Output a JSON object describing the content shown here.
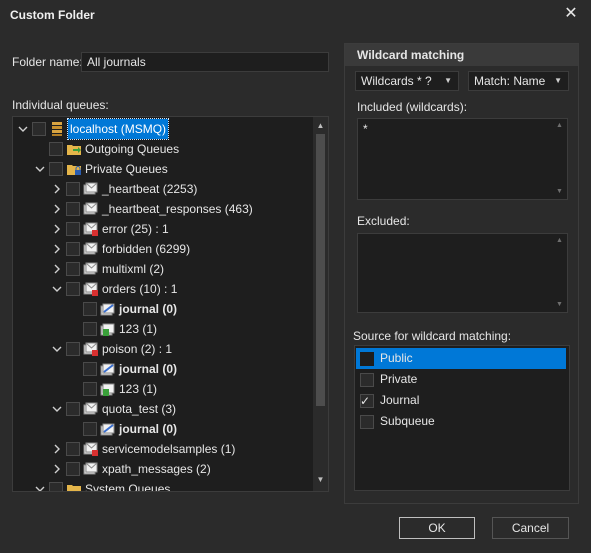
{
  "dialog": {
    "title": "Custom Folder",
    "close_glyph": "✕"
  },
  "folder_name": {
    "label": "Folder name:",
    "value": "All journals"
  },
  "queues_label": "Individual queues:",
  "tree": [
    {
      "id": "localhost",
      "label": "localhost (MSMQ)",
      "icon": "server-icon",
      "expander": "expanded",
      "checkbox": true,
      "selected": true,
      "bold": false
    },
    {
      "id": "outgoing",
      "label": "Outgoing Queues",
      "icon": "outgoing-folder-icon",
      "expander": "none",
      "checkbox": true,
      "selected": false,
      "bold": false
    },
    {
      "id": "private",
      "label": "Private Queues",
      "icon": "private-folder-icon",
      "expander": "expanded",
      "checkbox": true,
      "selected": false,
      "bold": false
    },
    {
      "id": "heartbeat",
      "label": "_heartbeat (2253)",
      "icon": "queue-icon",
      "expander": "collapsed",
      "checkbox": true,
      "selected": false,
      "bold": false
    },
    {
      "id": "heartbeat_responses",
      "label": "_heartbeat_responses (463)",
      "icon": "queue-icon",
      "expander": "collapsed",
      "checkbox": true,
      "selected": false,
      "bold": false
    },
    {
      "id": "error",
      "label": "error (25) : 1",
      "icon": "queue-error-icon",
      "expander": "collapsed",
      "checkbox": true,
      "selected": false,
      "bold": false
    },
    {
      "id": "forbidden",
      "label": "forbidden (6299)",
      "icon": "queue-icon",
      "expander": "collapsed",
      "checkbox": true,
      "selected": false,
      "bold": false
    },
    {
      "id": "multixml",
      "label": "multixml (2)",
      "icon": "queue-icon",
      "expander": "collapsed",
      "checkbox": true,
      "selected": false,
      "bold": false
    },
    {
      "id": "orders",
      "label": "orders (10) : 1",
      "icon": "queue-error-icon",
      "expander": "expanded",
      "checkbox": true,
      "selected": false,
      "bold": false
    },
    {
      "id": "orders_journal",
      "label": "journal (0)",
      "icon": "journal-icon",
      "expander": "none",
      "checkbox": true,
      "selected": false,
      "bold": true
    },
    {
      "id": "orders_123",
      "label": "123 (1)",
      "icon": "subqueue-icon",
      "expander": "none",
      "checkbox": true,
      "selected": false,
      "bold": false
    },
    {
      "id": "poison",
      "label": "poison (2) : 1",
      "icon": "queue-error-icon",
      "expander": "expanded",
      "checkbox": true,
      "selected": false,
      "bold": false
    },
    {
      "id": "poison_journal",
      "label": "journal (0)",
      "icon": "journal-icon",
      "expander": "none",
      "checkbox": true,
      "selected": false,
      "bold": true
    },
    {
      "id": "poison_123",
      "label": "123 (1)",
      "icon": "subqueue-icon",
      "expander": "none",
      "checkbox": true,
      "selected": false,
      "bold": false
    },
    {
      "id": "quota_test",
      "label": "quota_test (3)",
      "icon": "queue-icon",
      "expander": "expanded",
      "checkbox": true,
      "selected": false,
      "bold": false
    },
    {
      "id": "quota_journal",
      "label": "journal (0)",
      "icon": "journal-icon",
      "expander": "none",
      "checkbox": true,
      "selected": false,
      "bold": true
    },
    {
      "id": "servicemodelsamples",
      "label": "servicemodelsamples (1)",
      "icon": "queue-error-icon",
      "expander": "collapsed",
      "checkbox": true,
      "selected": false,
      "bold": false
    },
    {
      "id": "xpath_messages",
      "label": "xpath_messages (2)",
      "icon": "queue-icon",
      "expander": "collapsed",
      "checkbox": true,
      "selected": false,
      "bold": false
    },
    {
      "id": "system",
      "label": "System Queues",
      "icon": "folder-icon",
      "expander": "expanded",
      "checkbox": true,
      "selected": false,
      "bold": false
    }
  ],
  "wildcard": {
    "header": "Wildcard matching",
    "wildcards_combo": "Wildcards * ?",
    "match_combo": "Match: Name",
    "included_label": "Included (wildcards):",
    "included_value": "*",
    "excluded_label": "Excluded:",
    "excluded_value": "",
    "source_label": "Source for wildcard matching:",
    "sources": [
      {
        "label": "Public",
        "checked": false,
        "highlighted": true
      },
      {
        "label": "Private",
        "checked": false,
        "highlighted": false
      },
      {
        "label": "Journal",
        "checked": true,
        "highlighted": false
      },
      {
        "label": "Subqueue",
        "checked": false,
        "highlighted": false
      }
    ]
  },
  "buttons": {
    "ok": "OK",
    "cancel": "Cancel"
  },
  "colors": {
    "background": "#2b2b2b",
    "field": "#1e1e1e",
    "accent": "#0078d7",
    "border": "#3c3c3c",
    "text": "#e6e6e6"
  }
}
